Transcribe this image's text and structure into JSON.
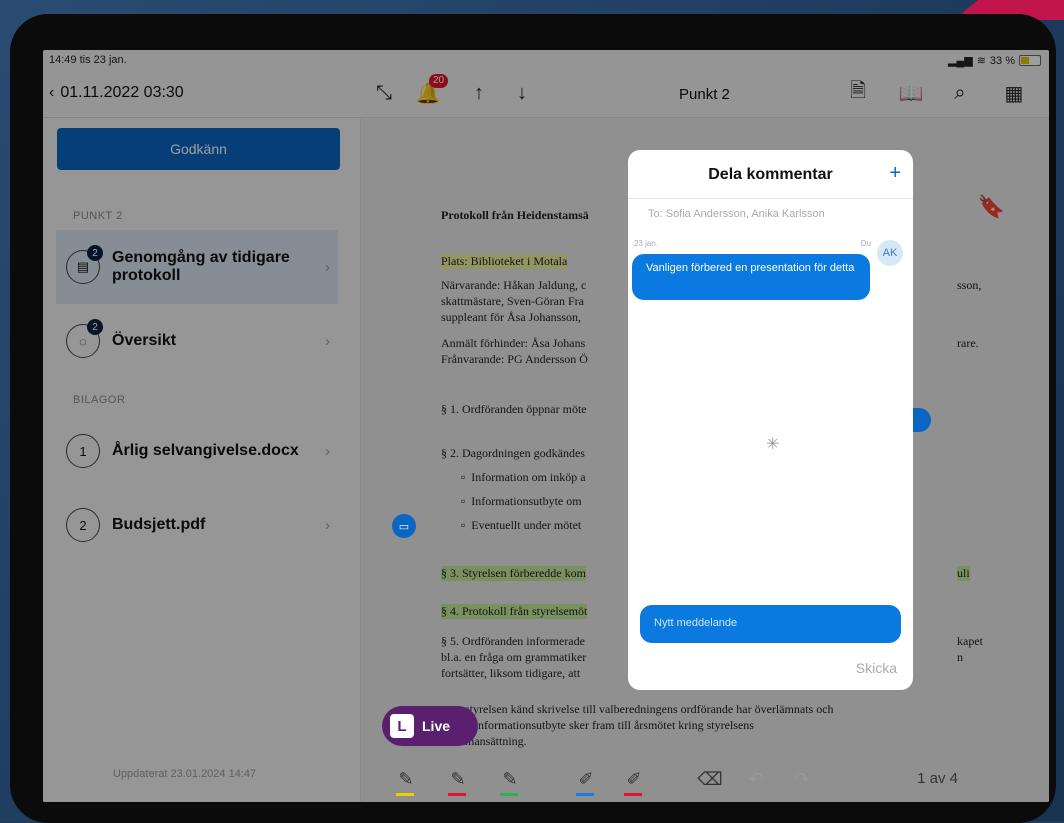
{
  "status": {
    "time": "14:49",
    "date": "tis 23 jan.",
    "battery": "33 %"
  },
  "nav": {
    "back_label": "01.11.2022 03:30",
    "notification_count": "20",
    "title": "Punkt 2"
  },
  "sidebar": {
    "approve_label": "Godkänn",
    "section_label": "PUNKT 2",
    "items": [
      {
        "label": "Genomgång av tidigare protokoll",
        "badge": "2"
      },
      {
        "label": "Översikt",
        "badge": "2"
      }
    ],
    "attachments_label": "BILAGOR",
    "attachments": [
      {
        "num": "1",
        "label": "Årlig selvangivelse.docx"
      },
      {
        "num": "2",
        "label": "Budsjett.pdf"
      }
    ],
    "updated": "Uppdaterat 23.01.2024 14:47"
  },
  "doc": {
    "heading": "Protokoll från Heidenstamsä",
    "place": "Plats: Biblioteket i Motala",
    "present1": "Närvarande: Håkan Jaldung, c",
    "present2": "skattmästare, Sven-Göran Fra",
    "present3": "suppleant för Åsa Johansson,",
    "absent1": "Anmält förhinder: Åsa Johans",
    "absent2": "Frånvarande: PG Andersson Ö",
    "p1": "§ 1. Ordföranden öppnar möte",
    "p2": "§ 2. Dagordningen godkändes",
    "b1": "Information om inköp a",
    "b2": "Informationsutbyte om",
    "b3": "Eventuellt under mötet",
    "p3": "§ 3. Styrelsen förberedde kom",
    "p4": "§ 4. Protokoll från styrelsemöt",
    "p5a": "§ 5. Ordföranden informerade",
    "p5b": "bl.a. en fråga om grammatiker",
    "p5c": "fortsätter, liksom tidigare, att",
    "r1": "sson,",
    "r2": "rare.",
    "r3": "uli",
    "r4": "kapet",
    "r5": "n",
    "tail1": "styrelsen känd skrivelse till valberedningens ordförande har överlämnats och",
    "tail2": "tt informationsutbyte sker fram till årsmötet kring styrelsens",
    "tail3": "mansättning."
  },
  "dialog": {
    "title": "Dela kommentar",
    "to": "To: Sofia Andersson, Anika Karlsson",
    "date": "23 jan.",
    "du": "Du",
    "avatar": "AK",
    "message": "Vanligen förbered en presentation för detta",
    "new_placeholder": "Nytt meddelande",
    "send": "Skicka"
  },
  "toolbar": {
    "pages": "1 av 4"
  },
  "live": {
    "label": "Live",
    "logo": "L"
  },
  "colors": {
    "accent": "#0a66c2",
    "pen_yellow": "#e8d400",
    "pen_red": "#e3142a",
    "pen_green": "#2bb24c",
    "pen_blue": "#1f7ae0",
    "live": "#5a1f6e"
  }
}
